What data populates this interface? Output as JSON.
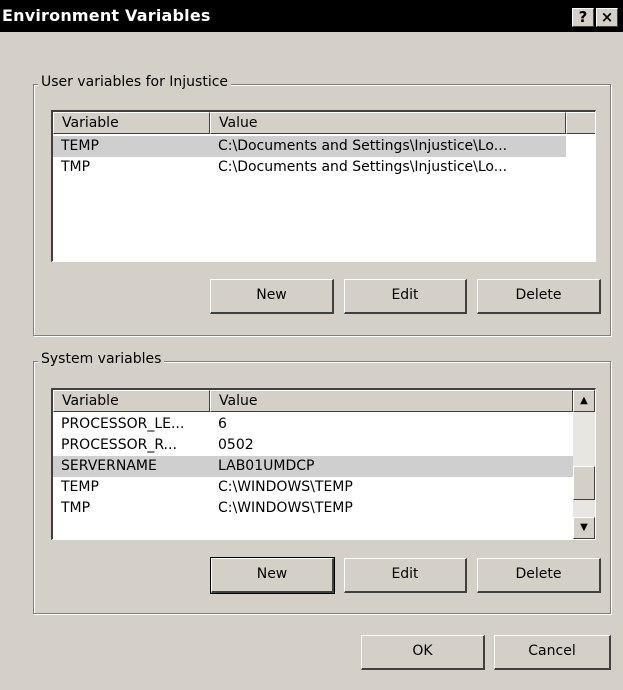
{
  "window": {
    "title": "Environment Variables",
    "help_glyph": "?",
    "close_glyph": "×"
  },
  "user_vars": {
    "group_title": "User variables for Injustice",
    "columns": [
      "Variable",
      "Value"
    ],
    "rows": [
      {
        "variable": "TEMP",
        "value": "C:\\Documents and Settings\\Injustice\\Lo...",
        "selected": true
      },
      {
        "variable": "TMP",
        "value": "C:\\Documents and Settings\\Injustice\\Lo...",
        "selected": false
      }
    ],
    "new_label": "New",
    "edit_label": "Edit",
    "delete_label": "Delete"
  },
  "system_vars": {
    "group_title": "System variables",
    "columns": [
      "Variable",
      "Value"
    ],
    "rows": [
      {
        "variable": "PROCESSOR_LE...",
        "value": "6",
        "selected": false
      },
      {
        "variable": "PROCESSOR_R...",
        "value": "0502",
        "selected": false
      },
      {
        "variable": "SERVERNAME",
        "value": "LAB01UMDCP",
        "selected": true
      },
      {
        "variable": "TEMP",
        "value": "C:\\WINDOWS\\TEMP",
        "selected": false
      },
      {
        "variable": "TMP",
        "value": "C:\\WINDOWS\\TEMP",
        "selected": false
      }
    ],
    "new_label": "New",
    "edit_label": "Edit",
    "delete_label": "Delete",
    "scroll_up_glyph": "▲",
    "scroll_down_glyph": "▼"
  },
  "footer": {
    "ok_label": "OK",
    "cancel_label": "Cancel"
  }
}
